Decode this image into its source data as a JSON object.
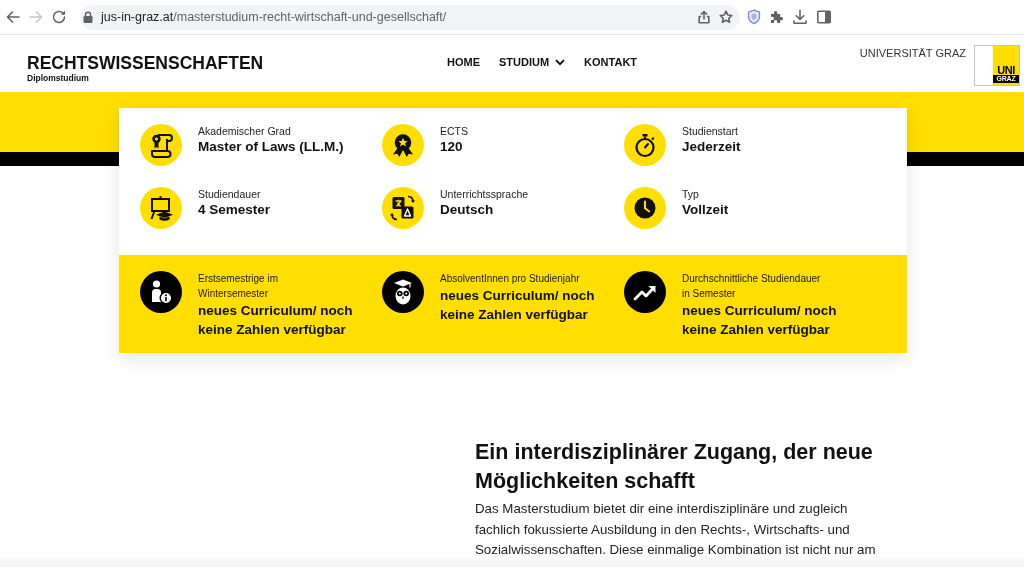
{
  "browser": {
    "url": {
      "host": "jus-in-graz.at",
      "path": "/masterstudium-recht-wirtschaft-und-gesellschaft/"
    }
  },
  "header": {
    "title": "RECHTSWISSENSCHAFTEN",
    "subtitle": "Diplomstudium",
    "nav": [
      {
        "label": "HOME",
        "dropdown": false
      },
      {
        "label": "STUDIUM",
        "dropdown": true
      },
      {
        "label": "KONTAKT",
        "dropdown": false
      }
    ],
    "university": "UNIVERSITÄT GRAZ",
    "logo": {
      "top": "UNI",
      "bottom": "GRAZ"
    }
  },
  "facts": [
    {
      "label": "Akademischer Grad",
      "value": "Master of Laws (LL.M.)"
    },
    {
      "label": "ECTS",
      "value": "120"
    },
    {
      "label": "Studienstart",
      "value": "Jederzeit"
    },
    {
      "label": "Studiendauer",
      "value": "4 Semester"
    },
    {
      "label": "Unterrichtssprache",
      "value": "Deutsch"
    },
    {
      "label": "Typ",
      "value": "Vollzeit"
    }
  ],
  "stats": [
    {
      "label": "Erstsemestrige im Wintersemester",
      "value": "neues Curriculum/ noch keine Zahlen verfügbar"
    },
    {
      "label": "AbsolventInnen pro Studienjahr",
      "value": "neues Curriculum/ noch keine Zahlen verfügbar"
    },
    {
      "label": "Durchschnittliche Studiendauer in Semester",
      "value": "neues Curriculum/ noch keine Zahlen verfügbar"
    }
  ],
  "article": {
    "heading": "Ein interdisziplinärer Zugang, der neue Möglichkeiten schafft",
    "paragraph": "Das Masterstudium bietet dir eine interdisziplinäre und zugleich fachlich fokussierte Ausbildung in den Rechts-, Wirtschafts- und Sozialwissenschaften. Diese einmalige Kombination ist nicht nur am"
  }
}
